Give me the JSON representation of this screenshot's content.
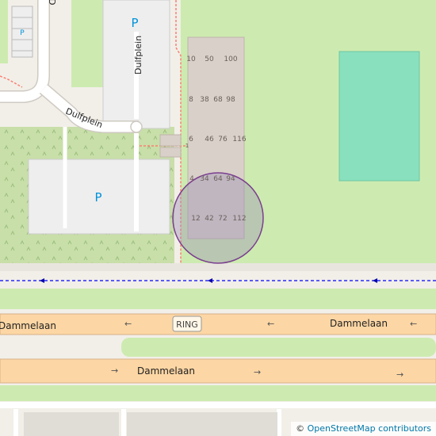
{
  "map": {
    "parking_symbol": "P",
    "street_dulfplein": "Dulfplein",
    "street_top_fragment": "D",
    "road_upper_label_left": "Dammelaan",
    "road_upper_label_right": "Dammelaan",
    "road_lower_label": "Dammelaan",
    "ring_shield": "RING",
    "house_numbers": [
      "10",
      "50",
      "100",
      "8",
      "38",
      "68",
      "98",
      "6",
      "46",
      "76",
      "116",
      "4",
      "34",
      "64",
      "94",
      "12",
      "42",
      "72",
      "112",
      "1"
    ],
    "arrow_left": "←",
    "arrow_right": "→"
  },
  "attribution": {
    "copyright": "©",
    "text": "OpenStreetMap contributors"
  },
  "colors": {
    "background": "#f2efe9",
    "grass": "#cdebb0",
    "pitch": "#88e0be",
    "building": "#d9d0c9",
    "parking": "#eeeeee",
    "road_orange": "#fcd6a4",
    "cycleway": "#0000ff",
    "footway": "#fa8072",
    "marker_fill": "#9c8fb5",
    "marker_stroke": "#7b3f8f"
  }
}
